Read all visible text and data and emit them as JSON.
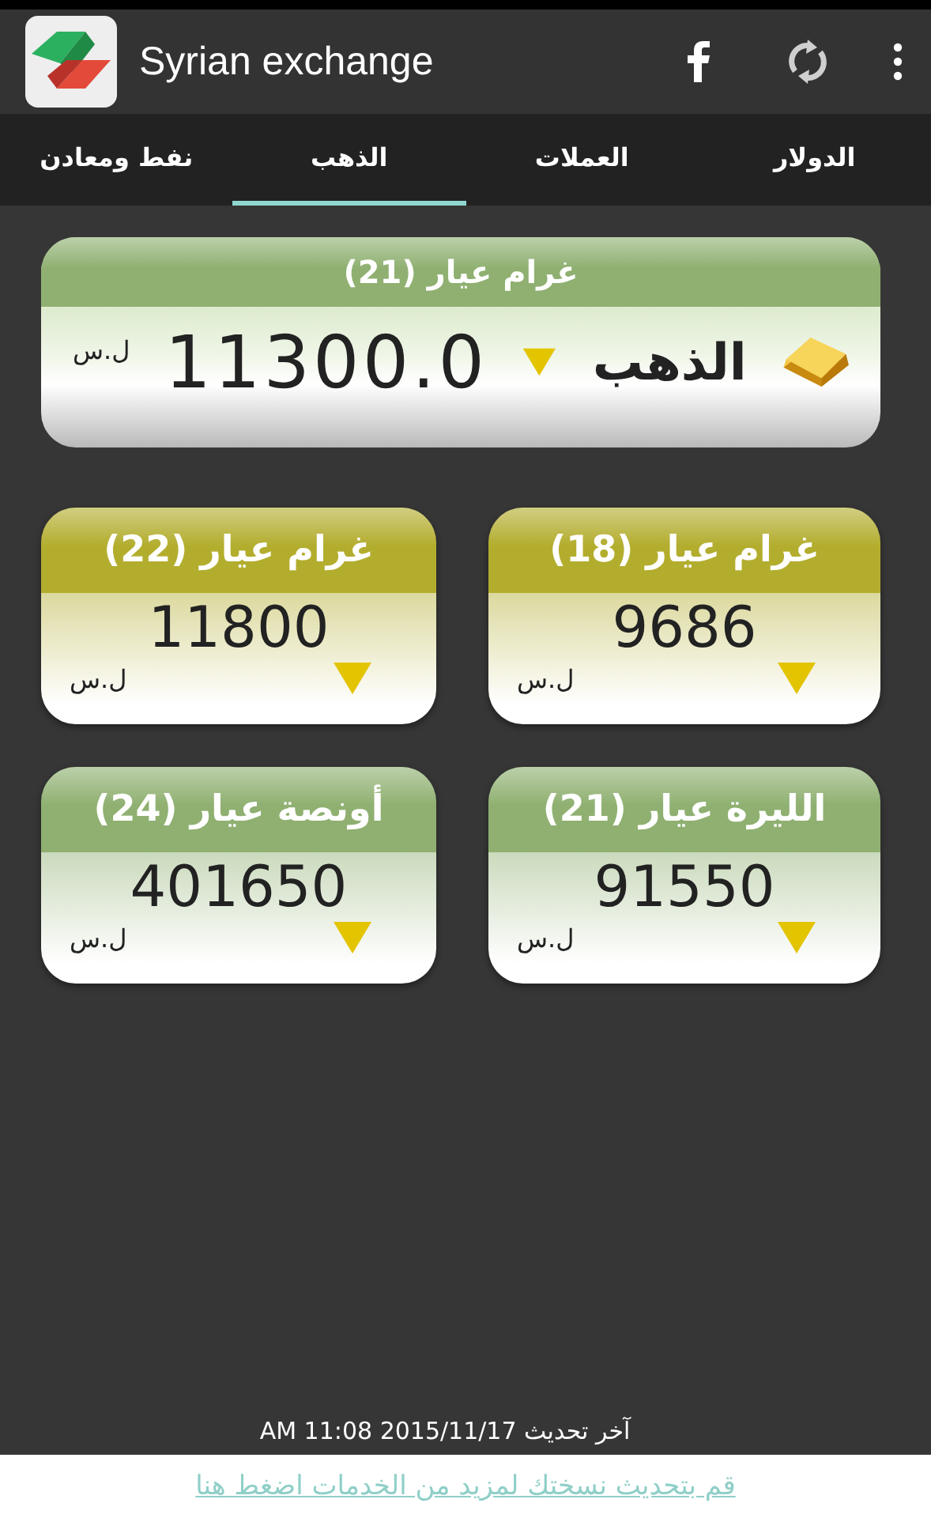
{
  "app_bar": {
    "title": "Syrian exchange"
  },
  "tabs": [
    {
      "label": "الدولار",
      "selected": false
    },
    {
      "label": "العملات",
      "selected": false
    },
    {
      "label": "الذهب",
      "selected": true
    },
    {
      "label": "نفط ومعادن",
      "selected": false
    }
  ],
  "main_card": {
    "header": "غرام عيار (21)",
    "name": "الذهب",
    "falling": true,
    "value": "11300.0",
    "currency": "ل.س",
    "color": "#8fb071"
  },
  "cards": [
    {
      "header": "غرام عيار (18)",
      "value": "9686",
      "currency": "ل.س",
      "falling": true,
      "color": "#b3ad2e"
    },
    {
      "header": "غرام عيار (22)",
      "value": "11800",
      "currency": "ل.س",
      "falling": true,
      "color": "#b3ad2e"
    },
    {
      "header": "الليرة عيار (21)",
      "value": "91550",
      "currency": "ل.س",
      "falling": true,
      "color": "#8fb071"
    },
    {
      "header": "أونصة عيار (24)",
      "value": "401650",
      "currency": "ل.س",
      "falling": true,
      "color": "#8fb071"
    }
  ],
  "last_update": "آخر تحديث 2015/11/17 11:08 AM",
  "update_link": "قم بتحديث نسختك لمزيد من الخدمات اضغط هنا"
}
